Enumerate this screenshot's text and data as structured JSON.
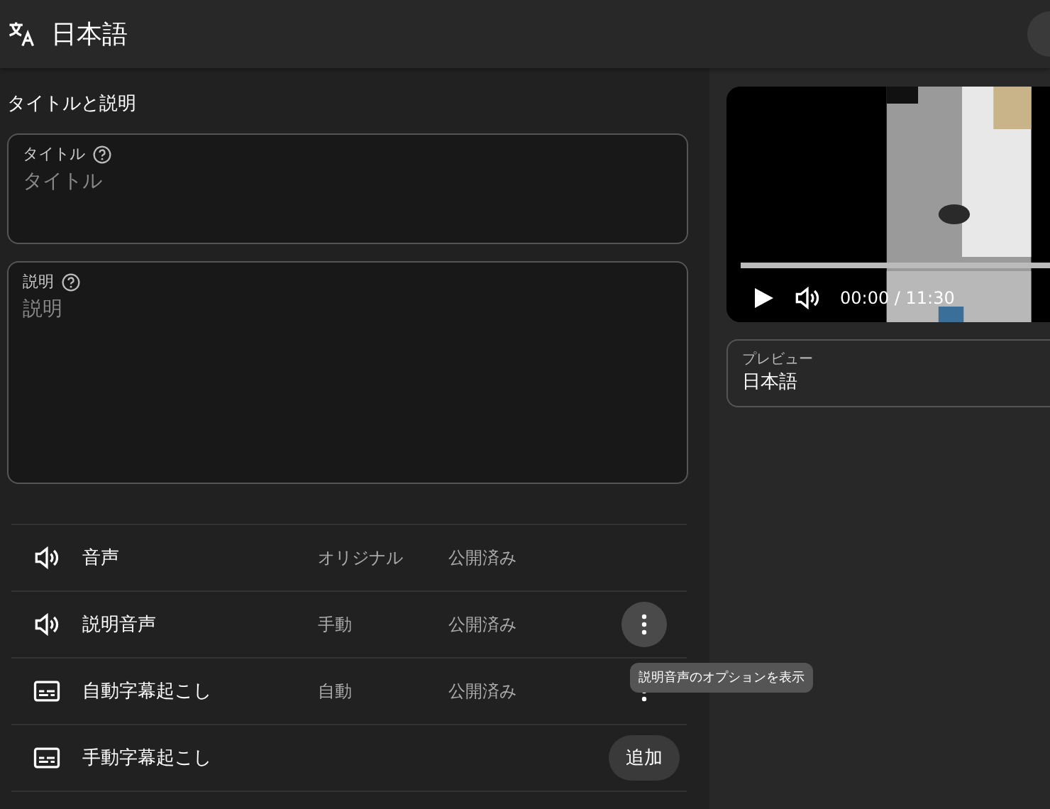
{
  "header": {
    "title": "日本語"
  },
  "section_title": "タイトルと説明",
  "fields": [
    {
      "label": "タイトル",
      "placeholder": "タイトル",
      "kind": "short"
    },
    {
      "label": "説明",
      "placeholder": "説明",
      "kind": "long"
    }
  ],
  "tracks": [
    {
      "kind": "audio",
      "name": "音声",
      "type": "オリジナル",
      "status": "公開済み"
    },
    {
      "kind": "audio",
      "name": "説明音声",
      "type": "手動",
      "status": "公開済み",
      "button": {
        "kind": "menu",
        "hovered": true
      }
    },
    {
      "kind": "subtitle",
      "name": "自動字幕起こし",
      "type": "自動",
      "status": "公開済み",
      "button": {
        "kind": "menu",
        "hovered": false
      }
    },
    {
      "kind": "subtitle",
      "name": "手動字幕起こし",
      "button": {
        "kind": "add",
        "label": "追加"
      }
    }
  ],
  "tooltip": "説明音声のオプションを表示",
  "video": {
    "time": "00:00 / 11:30"
  },
  "preview": {
    "label": "プレビュー",
    "value": "日本語"
  }
}
